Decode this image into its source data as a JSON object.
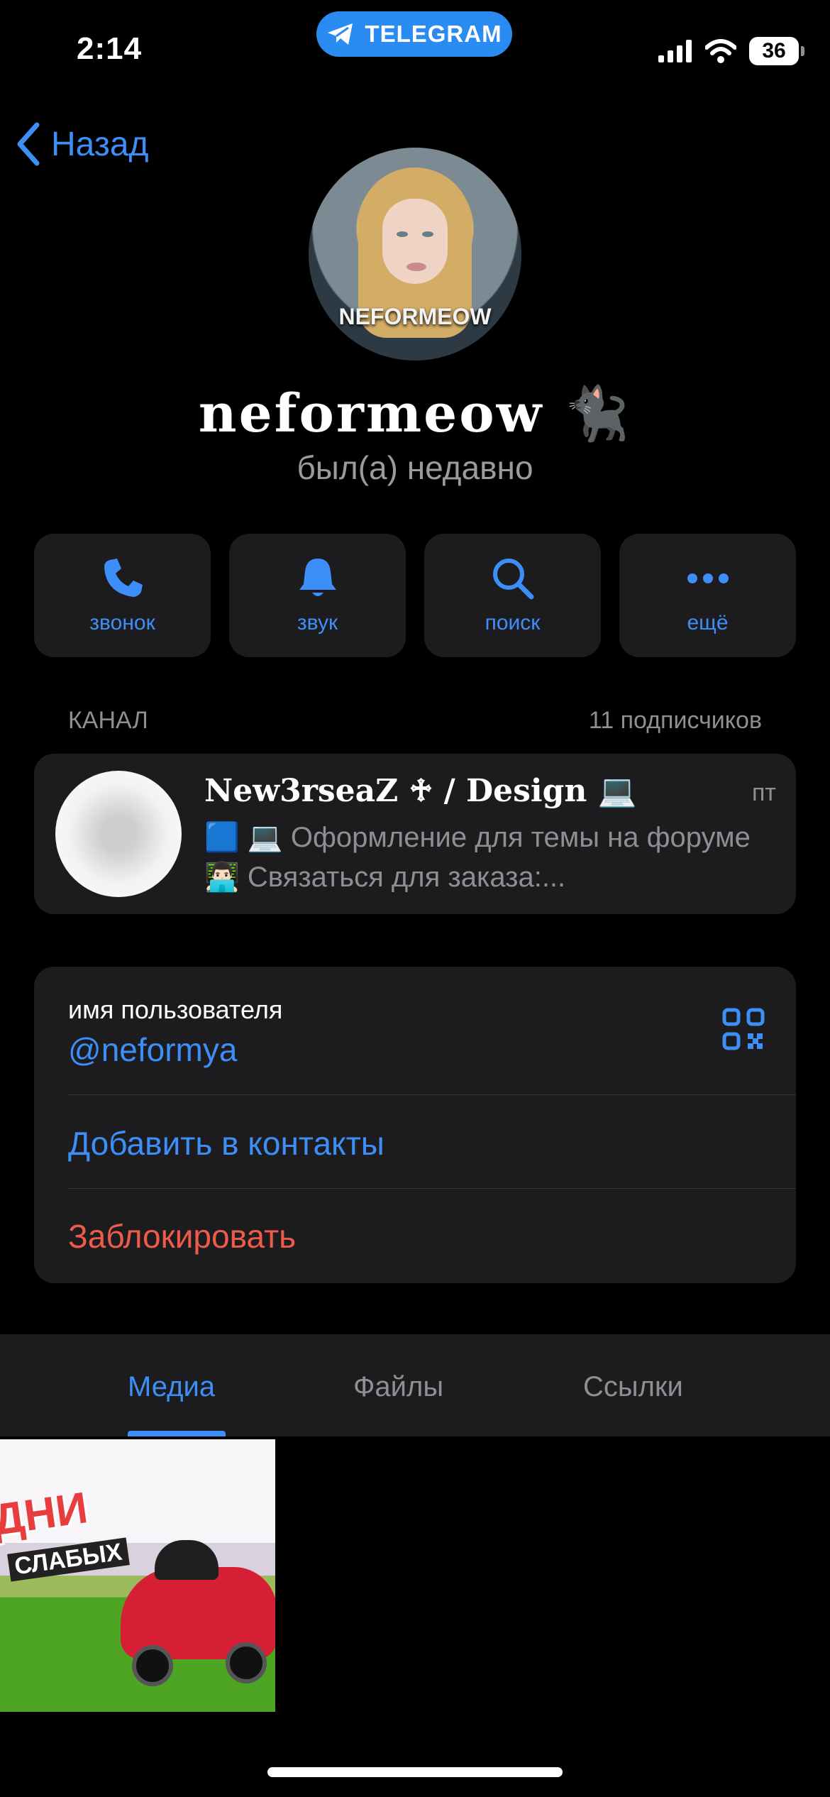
{
  "status_bar": {
    "time": "2:14",
    "app_pill": "TELEGRAM",
    "battery": "36"
  },
  "nav": {
    "back_label": "Назад"
  },
  "profile": {
    "avatar_text": "NEFORMEOW",
    "name": "neformeow 🐈‍⬛",
    "last_seen": "был(а) недавно"
  },
  "actions": [
    {
      "label": "звонок",
      "icon": "phone-icon"
    },
    {
      "label": "звук",
      "icon": "bell-icon"
    },
    {
      "label": "поиск",
      "icon": "search-icon"
    },
    {
      "label": "ещё",
      "icon": "more-icon"
    }
  ],
  "channel_section": {
    "title": "КАНАЛ",
    "subscribers": "11 подписчиков",
    "channel": {
      "name": "New3rseaZ ♱ / Design 💻",
      "date": "пт",
      "preview": "🟦 💻 Оформление для темы на форуме 👨🏻‍💻 Связаться для заказа:..."
    }
  },
  "info": {
    "username_label": "имя пользователя",
    "username_value": "@neformya",
    "add_contact": "Добавить в контакты",
    "block": "Заблокировать"
  },
  "tabs": [
    {
      "label": "Медиа",
      "active": true
    },
    {
      "label": "Файлы",
      "active": false
    },
    {
      "label": "Ссылки",
      "active": false
    }
  ],
  "media": {
    "tile_text_1": "ДНИ",
    "tile_text_2": "СЛАБЫХ"
  },
  "colors": {
    "accent": "#3e8ef7",
    "danger": "#ef5b4b",
    "card": "#1c1c1e",
    "secondary_text": "#8e8e93"
  }
}
